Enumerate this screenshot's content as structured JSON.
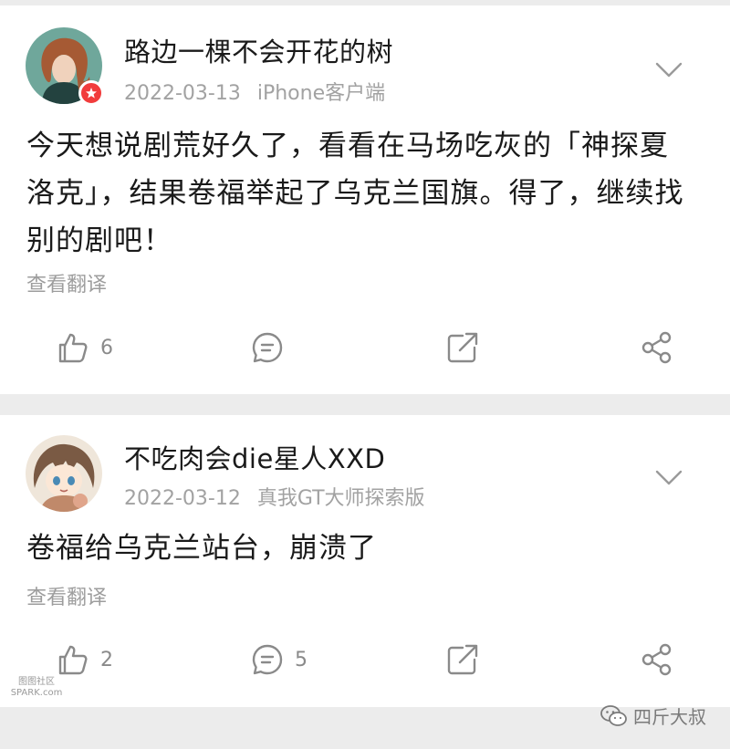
{
  "posts": [
    {
      "username": "路边一棵不会开花的树",
      "date": "2022-03-13",
      "device": "iPhone客户端",
      "text": "今天想说剧荒好久了，看看在马场吃灰的「神探夏洛克」，结果卷福举起了乌克兰国旗。得了，继续找别的剧吧！",
      "translate_label": "查看翻译",
      "like_count": "6",
      "comment_count": "",
      "verified": true,
      "avatar_icon": "woman-portrait-avatar"
    },
    {
      "username": "不吃肉会die星人XXD",
      "date": "2022-03-12",
      "device": "真我GT大师探索版",
      "text": "卷福给乌克兰站台，崩溃了",
      "translate_label": "查看翻译",
      "like_count": "2",
      "comment_count": "5",
      "verified": false,
      "avatar_icon": "anime-character-avatar"
    }
  ],
  "watermarks": {
    "left_top": "图图社区",
    "left_bottom": "SPARK.com",
    "right": "四斤大叔"
  },
  "colors": {
    "text": "#1a1a1a",
    "meta": "#a2a2a2",
    "icon": "#8a8a8a",
    "badge": "#f13c3c",
    "divider": "#ececec"
  }
}
